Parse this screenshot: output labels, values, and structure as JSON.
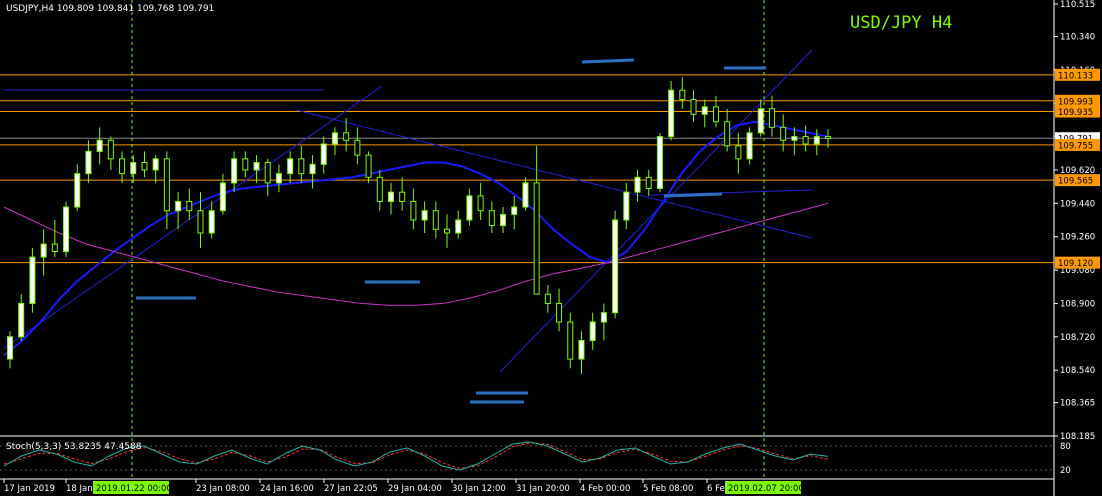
{
  "header": {
    "symbol_line": "USDJPY,H4  109.809 109.841 109.768 109.791",
    "title": "USD/JPY  H4"
  },
  "colors": {
    "background": "#000000",
    "grid_border": "#ffffff",
    "bull_candle": "#ffffff",
    "bear_candle": "#000000",
    "candle_wick": "#7CFC00",
    "ma_fast": "#1a1aff",
    "ma_slow": "#cc33cc",
    "horizontal_level": "#ff9900",
    "trendline": "#2222dd",
    "marker": "#2a6fc0",
    "vline": "#7CFC00",
    "stoch_main": "#20b2aa",
    "stoch_signal": "#ff3333",
    "price_label_bg": "#ff9900"
  },
  "chart_data": {
    "type": "candlestick",
    "title": "USD/JPY  H4",
    "ylim": [
      108.185,
      110.515
    ],
    "price_ticks": [
      "110.515",
      "110.340",
      "110.160",
      "109.980",
      "109.800",
      "109.620",
      "109.440",
      "109.260",
      "109.080",
      "108.900",
      "108.720",
      "108.540",
      "108.365",
      "108.185"
    ],
    "level_labels": [
      {
        "label": "110.133",
        "value": 110.133
      },
      {
        "label": "109.993",
        "value": 109.993
      },
      {
        "label": "109.935",
        "value": 109.935
      },
      {
        "label": "109.791",
        "value": 109.791
      },
      {
        "label": "109.755",
        "value": 109.755
      },
      {
        "label": "109.565",
        "value": 109.565
      },
      {
        "label": "109.120",
        "value": 109.12
      }
    ],
    "time_labels": [
      "17 Jan 2019",
      "18 Jan",
      "23 Jan 08:00",
      "24 Jan 16:00",
      "27 Jan 22:05",
      "29 Jan 04:00",
      "30 Jan 12:00",
      "31 Jan 20:00",
      "4 Feb 00:00",
      "5 Feb 08:00",
      "6 Fe"
    ],
    "highlighted_times": [
      "2019.01.22 00:00",
      "2019.02.07 20:00"
    ],
    "candles": [
      [
        108.6,
        108.75,
        108.55,
        108.72
      ],
      [
        108.72,
        108.95,
        108.7,
        108.9
      ],
      [
        108.9,
        109.2,
        108.85,
        109.15
      ],
      [
        109.15,
        109.3,
        109.05,
        109.22
      ],
      [
        109.22,
        109.35,
        109.15,
        109.18
      ],
      [
        109.18,
        109.45,
        109.15,
        109.42
      ],
      [
        109.42,
        109.65,
        109.4,
        109.6
      ],
      [
        109.6,
        109.78,
        109.55,
        109.72
      ],
      [
        109.72,
        109.85,
        109.65,
        109.78
      ],
      [
        109.78,
        109.8,
        109.62,
        109.68
      ],
      [
        109.68,
        109.72,
        109.55,
        109.6
      ],
      [
        109.6,
        109.7,
        109.55,
        109.66
      ],
      [
        109.66,
        109.72,
        109.58,
        109.62
      ],
      [
        109.62,
        109.7,
        109.55,
        109.68
      ],
      [
        109.68,
        109.72,
        109.3,
        109.4
      ],
      [
        109.4,
        109.5,
        109.3,
        109.45
      ],
      [
        109.45,
        109.52,
        109.35,
        109.4
      ],
      [
        109.4,
        109.5,
        109.2,
        109.28
      ],
      [
        109.28,
        109.45,
        109.25,
        109.4
      ],
      [
        109.4,
        109.6,
        109.38,
        109.55
      ],
      [
        109.55,
        109.72,
        109.5,
        109.68
      ],
      [
        109.68,
        109.72,
        109.58,
        109.62
      ],
      [
        109.62,
        109.7,
        109.55,
        109.66
      ],
      [
        109.66,
        109.68,
        109.48,
        109.55
      ],
      [
        109.55,
        109.65,
        109.5,
        109.6
      ],
      [
        109.6,
        109.72,
        109.55,
        109.68
      ],
      [
        109.68,
        109.75,
        109.55,
        109.6
      ],
      [
        109.6,
        109.7,
        109.52,
        109.65
      ],
      [
        109.65,
        109.8,
        109.6,
        109.76
      ],
      [
        109.76,
        109.85,
        109.7,
        109.82
      ],
      [
        109.82,
        109.9,
        109.72,
        109.78
      ],
      [
        109.78,
        109.85,
        109.65,
        109.7
      ],
      [
        109.7,
        109.72,
        109.55,
        109.58
      ],
      [
        109.58,
        109.62,
        109.4,
        109.45
      ],
      [
        109.45,
        109.55,
        109.38,
        109.5
      ],
      [
        109.5,
        109.58,
        109.4,
        109.45
      ],
      [
        109.45,
        109.52,
        109.3,
        109.35
      ],
      [
        109.35,
        109.45,
        109.28,
        109.4
      ],
      [
        109.4,
        109.45,
        109.25,
        109.3
      ],
      [
        109.3,
        109.38,
        109.2,
        109.28
      ],
      [
        109.28,
        109.4,
        109.25,
        109.35
      ],
      [
        109.35,
        109.52,
        109.32,
        109.48
      ],
      [
        109.48,
        109.55,
        109.35,
        109.4
      ],
      [
        109.4,
        109.45,
        109.28,
        109.32
      ],
      [
        109.32,
        109.42,
        109.28,
        109.38
      ],
      [
        109.38,
        109.48,
        109.3,
        109.42
      ],
      [
        109.42,
        109.58,
        109.4,
        109.55
      ],
      [
        109.55,
        109.75,
        109.0,
        108.95
      ],
      [
        108.95,
        109.0,
        108.85,
        108.9
      ],
      [
        108.9,
        108.98,
        108.75,
        108.8
      ],
      [
        108.8,
        108.85,
        108.55,
        108.6
      ],
      [
        108.6,
        108.75,
        108.52,
        108.7
      ],
      [
        108.7,
        108.85,
        108.65,
        108.8
      ],
      [
        108.8,
        108.9,
        108.7,
        108.85
      ],
      [
        108.85,
        109.4,
        108.82,
        109.35
      ],
      [
        109.35,
        109.55,
        109.3,
        109.5
      ],
      [
        109.5,
        109.62,
        109.45,
        109.58
      ],
      [
        109.58,
        109.62,
        109.48,
        109.52
      ],
      [
        109.52,
        109.82,
        109.5,
        109.8
      ],
      [
        109.8,
        110.1,
        109.78,
        110.05
      ],
      [
        110.05,
        110.12,
        109.95,
        110.0
      ],
      [
        110.0,
        110.05,
        109.88,
        109.92
      ],
      [
        109.92,
        110.0,
        109.85,
        109.96
      ],
      [
        109.96,
        110.02,
        109.85,
        109.88
      ],
      [
        109.88,
        109.95,
        109.72,
        109.75
      ],
      [
        109.75,
        109.82,
        109.6,
        109.68
      ],
      [
        109.68,
        109.85,
        109.65,
        109.82
      ],
      [
        109.82,
        110.0,
        109.8,
        109.95
      ],
      [
        109.95,
        110.02,
        109.8,
        109.85
      ],
      [
        109.85,
        109.92,
        109.72,
        109.78
      ],
      [
        109.78,
        109.85,
        109.7,
        109.8
      ],
      [
        109.8,
        109.86,
        109.72,
        109.76
      ],
      [
        109.76,
        109.84,
        109.7,
        109.8
      ],
      [
        109.8,
        109.84,
        109.74,
        109.79
      ]
    ],
    "series": [
      {
        "name": "MA fast",
        "values": [
          108.62,
          108.7,
          108.8,
          108.92,
          109.02,
          109.1,
          109.18,
          109.25,
          109.32,
          109.38,
          109.42,
          109.46,
          109.5,
          109.52,
          109.53,
          109.54,
          109.55,
          109.56,
          109.57,
          109.58,
          109.6,
          109.62,
          109.64,
          109.66,
          109.66,
          109.64,
          109.6,
          109.55,
          109.48,
          109.4,
          109.3,
          109.22,
          109.15,
          109.12,
          109.18,
          109.3,
          109.45,
          109.6,
          109.72,
          109.8,
          109.86,
          109.88,
          109.86,
          109.84,
          109.82,
          109.8
        ]
      },
      {
        "name": "MA slow",
        "values": [
          109.42,
          109.35,
          109.28,
          109.22,
          109.18,
          109.14,
          109.1,
          109.06,
          109.02,
          108.99,
          108.96,
          108.94,
          108.92,
          108.9,
          108.89,
          108.89,
          108.9,
          108.93,
          108.97,
          109.02,
          109.06,
          109.09,
          109.12,
          109.16,
          109.2,
          109.24,
          109.28,
          109.32,
          109.36,
          109.4,
          109.44
        ]
      }
    ],
    "stochastic": {
      "label": "Stoch(5,3,3) 53.8235 47.4588",
      "ylim": [
        0,
        100
      ],
      "ticks": [
        "80",
        "20"
      ],
      "main": [
        30,
        55,
        70,
        60,
        40,
        30,
        55,
        75,
        80,
        60,
        40,
        35,
        55,
        70,
        50,
        35,
        60,
        80,
        70,
        45,
        30,
        40,
        65,
        75,
        55,
        30,
        20,
        35,
        60,
        85,
        90,
        80,
        60,
        40,
        50,
        70,
        75,
        55,
        35,
        40,
        60,
        75,
        85,
        70,
        55,
        45,
        60,
        54
      ],
      "signal": [
        35,
        48,
        62,
        62,
        48,
        36,
        48,
        66,
        76,
        66,
        48,
        38,
        48,
        64,
        56,
        40,
        52,
        72,
        72,
        52,
        36,
        38,
        58,
        70,
        60,
        38,
        24,
        30,
        52,
        78,
        88,
        84,
        66,
        46,
        48,
        64,
        72,
        60,
        42,
        40,
        54,
        70,
        80,
        74,
        60,
        48,
        56,
        47
      ]
    }
  }
}
